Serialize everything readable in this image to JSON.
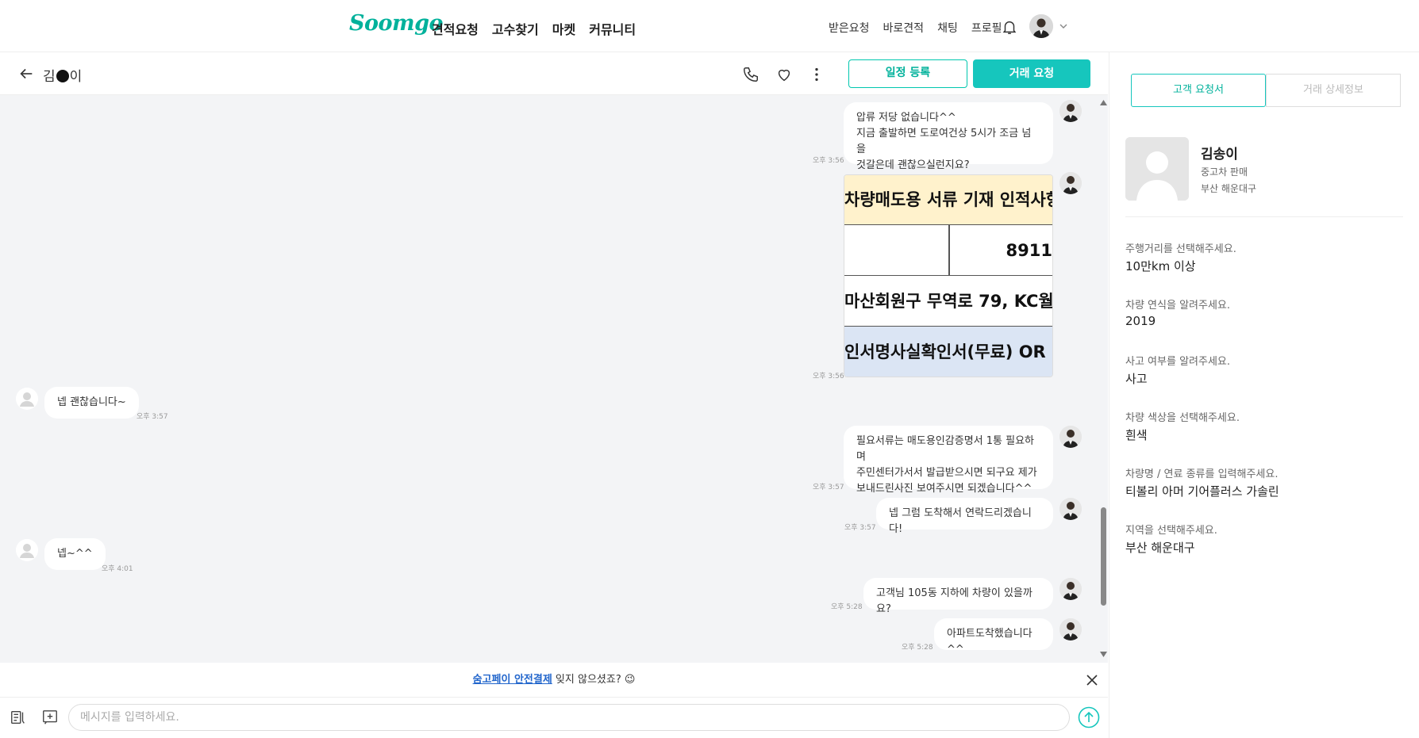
{
  "topnav": {
    "logo": "Soomgo",
    "main_links": [
      "견적요청",
      "고수찾기",
      "마켓",
      "커뮤니티"
    ],
    "user_links": [
      "받은요청",
      "바로견적",
      "채팅",
      "프로필"
    ],
    "icons": [
      "bell-icon",
      "avatar",
      "chevron-down-icon"
    ]
  },
  "chat_header": {
    "name_first": "김",
    "name_last": "이",
    "schedule_button": "일정 등록",
    "deal_button": "거래 요청",
    "icons": [
      "back-arrow-icon",
      "phone-icon",
      "heart-icon",
      "more-vertical-icon"
    ]
  },
  "messages": [
    {
      "from": "me",
      "text": "압류 저당 없습니다^^\n지금 출발하면 도로여건상 5시가 조금 넘을\n것갈은데 괜찮으실런지요?",
      "time": "오후 3:56"
    },
    {
      "from": "me",
      "type": "image",
      "time": "오후 3:56",
      "image_rows": [
        "차량매도용 서류 기재 인적사항",
        "8911",
        "마산회원구 무역로 79, KC월",
        "인서명사실확인서(무료) OR"
      ]
    },
    {
      "from": "other",
      "text": "넵 괜찮습니다~",
      "time": "오후 3:57"
    },
    {
      "from": "me",
      "text": "필요서류는 매도용인감증명서 1통 필요하며\n주민센터가서서 발급받으시면 되구요 제가\n보내드린사진 보여주시면 되겠습니다^^",
      "time": "오후 3:57"
    },
    {
      "from": "me",
      "text": "넵 그럼 도착해서 연락드리겠습니다!",
      "time": "오후 3:57"
    },
    {
      "from": "other",
      "text": "넵~^^",
      "time": "오후 4:01"
    },
    {
      "from": "me",
      "text": "고객님 105동 지하에 차량이 있을까요?",
      "time": "오후 5:28"
    },
    {
      "from": "me",
      "text": "아파트도착했습니다^^",
      "time": "오후 5:28"
    }
  ],
  "notice": {
    "link_text": "숨고페이 안전결제",
    "rest_text": " 잊지 않으셨죠? 😉"
  },
  "composer": {
    "placeholder": "메시지를 입력하세요.",
    "icons": [
      "template-icon",
      "add-attachment-icon",
      "send-icon"
    ]
  },
  "right_panel": {
    "tabs": [
      "고객 요청서",
      "거래 상세정보"
    ],
    "active_tab": 0,
    "profile": {
      "name": "김송이",
      "service": "중고차 판매",
      "location": "부산 해운대구"
    },
    "questions": [
      {
        "label": "주행거리를 선택해주세요.",
        "value": "10만km 이상"
      },
      {
        "label": "차량 연식을 알려주세요.",
        "value": "2019"
      },
      {
        "label": "사고 여부를 알려주세요.",
        "value": "사고"
      },
      {
        "label": "차량 색상을 선택해주세요.",
        "value": "흰색"
      },
      {
        "label": "차량명 / 연료 종류를 입력해주세요.",
        "value": "티볼리 아머 기어플러스 가솔린"
      },
      {
        "label": "지역을 선택해주세요.",
        "value": "부산 해운대구"
      }
    ]
  },
  "colors": {
    "brand": "#00b19b",
    "accent_button": "#16c6bd",
    "chat_bg": "#f3f4f6",
    "link": "#2266cc"
  }
}
